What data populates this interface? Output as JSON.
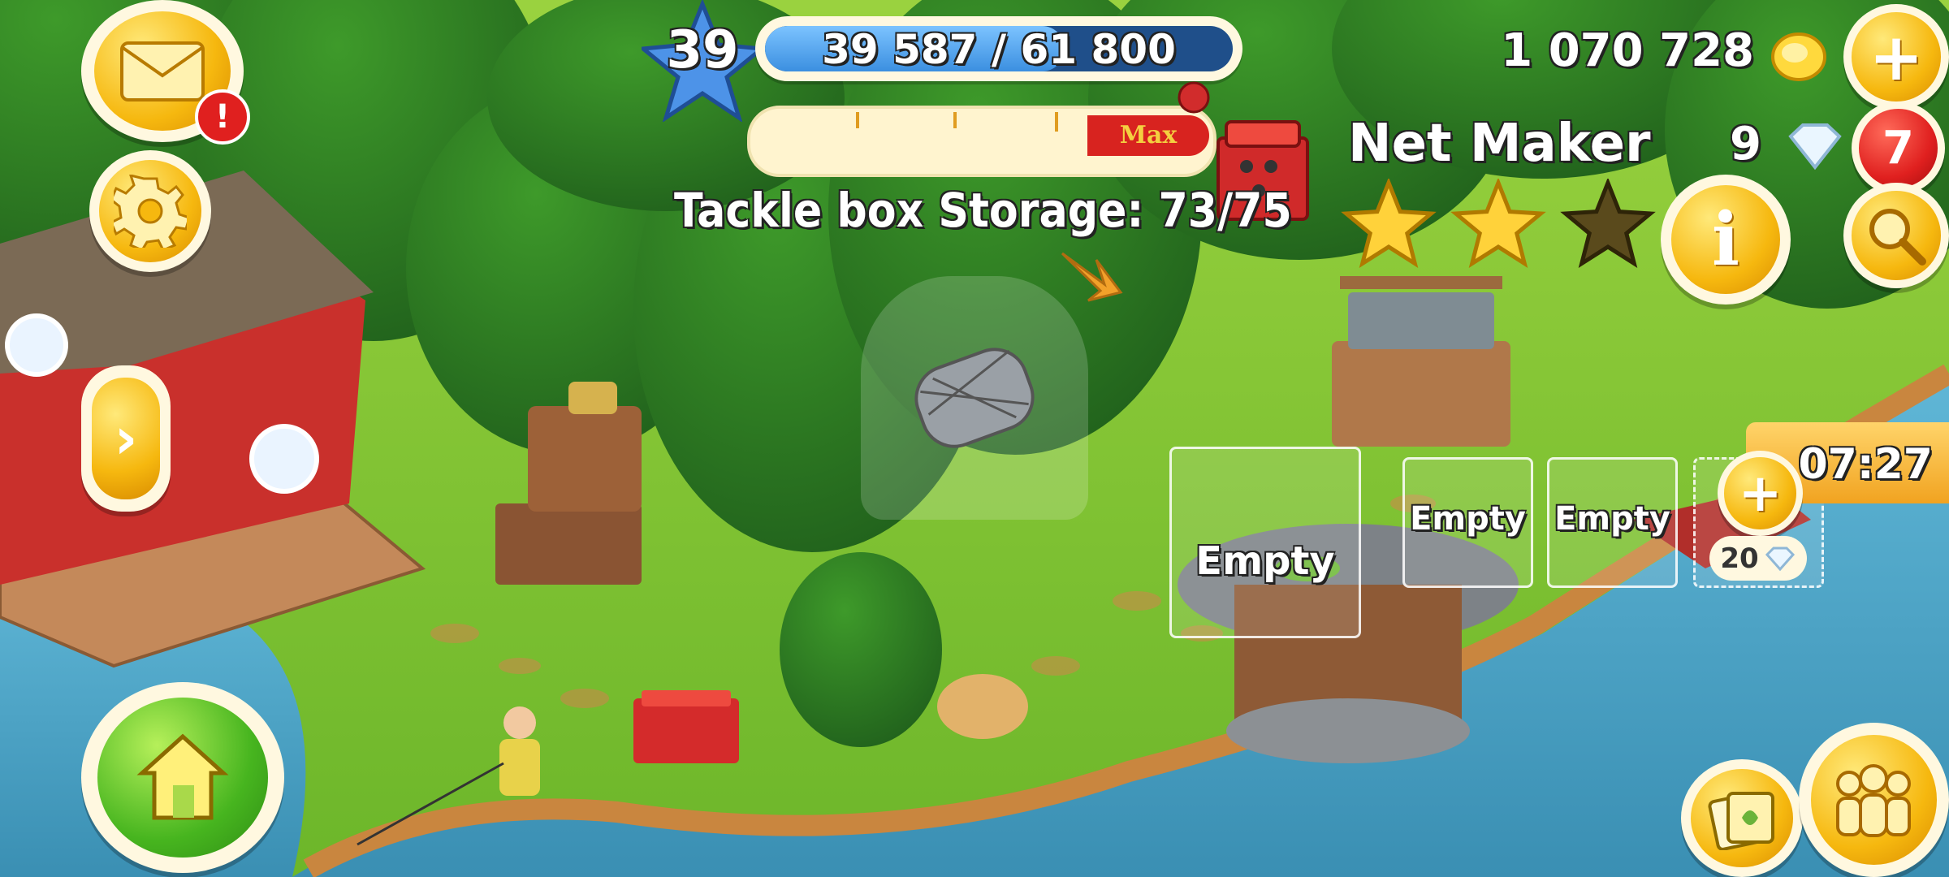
{
  "level": {
    "number": "39",
    "xp_text": "39 587 / 61 800",
    "progress": 0.64
  },
  "currency": {
    "coins": "1 070 728",
    "diamonds": "9"
  },
  "notifications": {
    "mail_alert": "!",
    "red_badge": "7"
  },
  "building": {
    "name": "Net Maker",
    "stars_filled": 2,
    "stars_total": 3,
    "storage_text": "Tackle box Storage: 73/75",
    "timeline_label": "Max"
  },
  "production_slots": [
    {
      "label": "Empty"
    },
    {
      "label": "Empty"
    },
    {
      "label": "Empty"
    }
  ],
  "extra_slot": {
    "timer": "07:27",
    "cost": "20"
  },
  "colors": {
    "gold": "#f6b80f",
    "xp_blue": "#3b8fe0",
    "badge_red": "#e0201f",
    "grass": "#7cc531",
    "water": "#4ea7c9"
  },
  "icons": [
    "mail-icon",
    "gear-icon",
    "arrow-right-icon",
    "home-icon",
    "coin-icon",
    "diamond-icon",
    "plus-icon",
    "info-icon",
    "magnifier-icon",
    "cards-icon",
    "friends-icon",
    "star-icon"
  ]
}
